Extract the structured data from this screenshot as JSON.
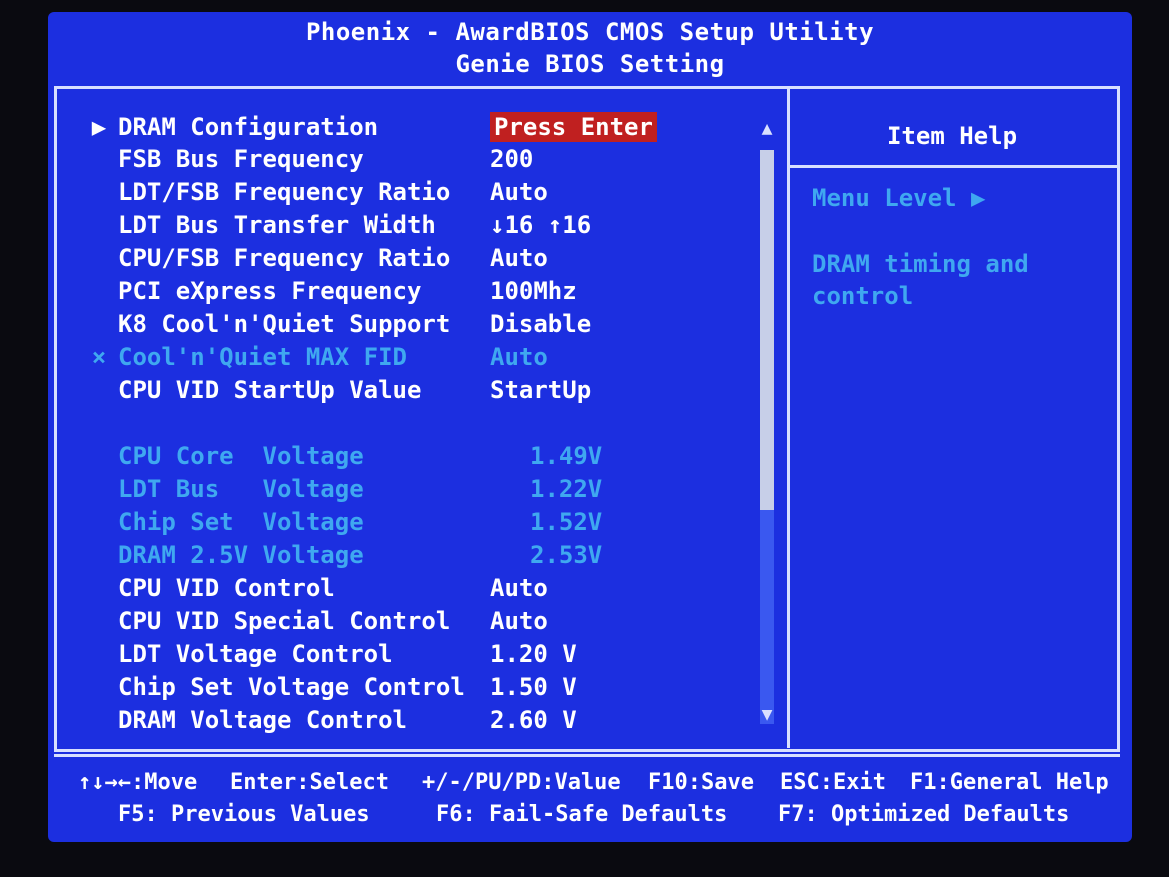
{
  "header": {
    "title": "Phoenix - AwardBIOS CMOS Setup Utility",
    "subtitle": "Genie BIOS Setting"
  },
  "settings": [
    {
      "mark": "▶",
      "label": "DRAM Configuration",
      "value": "Press Enter",
      "state": "highlighted"
    },
    {
      "mark": "",
      "label": "FSB Bus Frequency",
      "value": "200",
      "state": "normal"
    },
    {
      "mark": "",
      "label": "LDT/FSB Frequency Ratio",
      "value": "Auto",
      "state": "normal"
    },
    {
      "mark": "",
      "label": "LDT Bus Transfer Width",
      "value": "↓16 ↑16",
      "state": "normal"
    },
    {
      "mark": "",
      "label": "CPU/FSB Frequency Ratio",
      "value": "Auto",
      "state": "normal"
    },
    {
      "mark": "",
      "label": "PCI eXpress Frequency",
      "value": "100Mhz",
      "state": "normal"
    },
    {
      "mark": "",
      "label": "K8 Cool'n'Quiet Support",
      "value": "Disable",
      "state": "normal"
    },
    {
      "mark": "×",
      "label": "Cool'n'Quiet MAX FID",
      "value": "Auto",
      "state": "disabled"
    },
    {
      "mark": "",
      "label": "CPU VID StartUp Value",
      "value": "StartUp",
      "state": "normal"
    },
    {
      "mark": "",
      "label": "CPU Core  Voltage",
      "value": "1.49V",
      "state": "disabled"
    },
    {
      "mark": "",
      "label": "LDT Bus   Voltage",
      "value": "1.22V",
      "state": "disabled"
    },
    {
      "mark": "",
      "label": "Chip Set  Voltage",
      "value": "1.52V",
      "state": "disabled"
    },
    {
      "mark": "",
      "label": "DRAM 2.5V Voltage",
      "value": "2.53V",
      "state": "disabled"
    },
    {
      "mark": "",
      "label": "CPU VID Control",
      "value": "Auto",
      "state": "normal"
    },
    {
      "mark": "",
      "label": "CPU VID Special Control",
      "value": "Auto",
      "state": "normal"
    },
    {
      "mark": "",
      "label": "LDT Voltage Control",
      "value": "1.20 V",
      "state": "normal"
    },
    {
      "mark": "",
      "label": "Chip Set Voltage Control",
      "value": "1.50 V",
      "state": "normal"
    },
    {
      "mark": "",
      "label": "DRAM Voltage Control",
      "value": "2.60 V",
      "state": "normal"
    }
  ],
  "help": {
    "title": "Item Help",
    "menu_level": "Menu Level   ▶",
    "lines": [
      "DRAM timing and",
      "control"
    ]
  },
  "scrollbar": {
    "up_arrow": "▲",
    "down_arrow": "▼"
  },
  "footer": {
    "row1": [
      "↑↓→←:Move",
      "Enter:Select",
      "+/-/PU/PD:Value",
      "F10:Save",
      "ESC:Exit",
      "F1:General Help"
    ],
    "row2": [
      "F5: Previous Values",
      "F6: Fail-Safe Defaults",
      "F7: Optimized Defaults"
    ]
  },
  "colors": {
    "background": "#1c2fe0",
    "text": "#ffffff",
    "disabled_text": "#3fa8f0",
    "highlight": "#c02020"
  }
}
